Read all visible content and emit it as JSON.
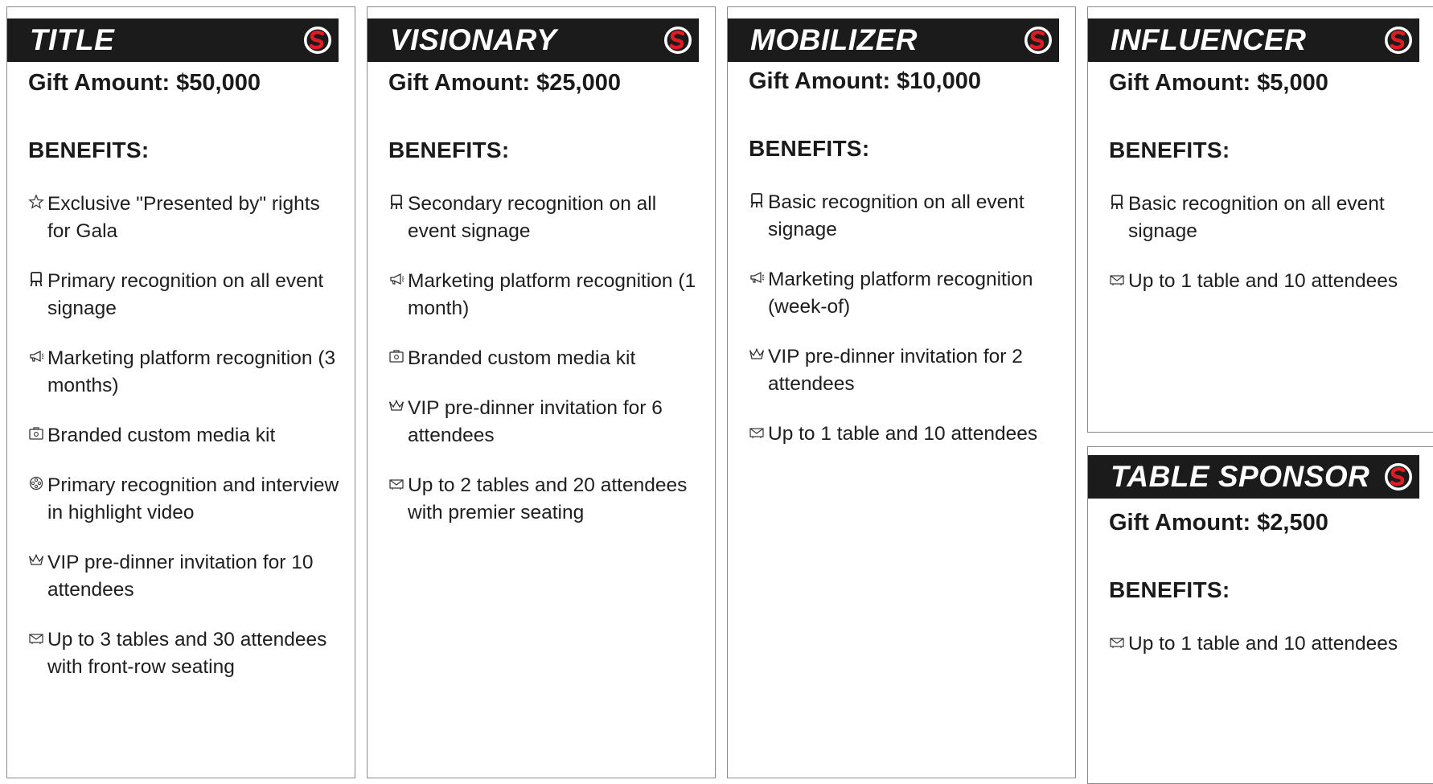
{
  "tiers": [
    {
      "name": "TITLE",
      "gift": "Gift Amount: $50,000",
      "benefits_heading": "BENEFITS:",
      "benefits": [
        {
          "icon": "star-icon",
          "text": "Exclusive \"Presented by\" rights for Gala"
        },
        {
          "icon": "signage-icon",
          "text": "Primary recognition on all event signage"
        },
        {
          "icon": "megaphone-icon",
          "text": "Marketing platform recognition (3 months)"
        },
        {
          "icon": "media-kit-icon",
          "text": "Branded custom media kit"
        },
        {
          "icon": "film-reel-icon",
          "text": "Primary recognition and interview in highlight video"
        },
        {
          "icon": "crown-icon",
          "text": "VIP pre-dinner invitation for 10 attendees"
        },
        {
          "icon": "ticket-icon",
          "text": "Up to 3 tables and 30 attendees with front-row seating"
        }
      ]
    },
    {
      "name": "VISIONARY",
      "gift": "Gift Amount: $25,000",
      "benefits_heading": "BENEFITS:",
      "benefits": [
        {
          "icon": "signage-icon",
          "text": "Secondary recognition on all event signage"
        },
        {
          "icon": "megaphone-icon",
          "text": "Marketing platform recognition (1 month)"
        },
        {
          "icon": "media-kit-icon",
          "text": "Branded custom media kit"
        },
        {
          "icon": "crown-icon",
          "text": "VIP pre-dinner invitation for 6 attendees"
        },
        {
          "icon": "ticket-icon",
          "text": "Up to 2 tables and 20 attendees with premier seating"
        }
      ]
    },
    {
      "name": "MOBILIZER",
      "gift": "Gift Amount: $10,000",
      "benefits_heading": "BENEFITS:",
      "benefits": [
        {
          "icon": "signage-icon",
          "text": "Basic recognition on all event signage"
        },
        {
          "icon": "megaphone-icon",
          "text": "Marketing platform recognition (week-of)"
        },
        {
          "icon": "crown-icon",
          "text": "VIP pre-dinner invitation for 2 attendees"
        },
        {
          "icon": "ticket-icon",
          "text": "Up to 1 table and 10 attendees"
        }
      ]
    },
    {
      "name": "INFLUENCER",
      "gift": "Gift Amount: $5,000",
      "benefits_heading": "BENEFITS:",
      "benefits": [
        {
          "icon": "signage-icon",
          "text": "Basic recognition on all event signage"
        },
        {
          "icon": "ticket-icon",
          "text": "Up to 1 table and 10 attendees"
        }
      ]
    },
    {
      "name": "TABLE SPONSOR",
      "gift": "Gift Amount: $2,500",
      "benefits_heading": "BENEFITS:",
      "benefits": [
        {
          "icon": "ticket-icon",
          "text": "Up to 1 table and 10 attendees"
        }
      ]
    }
  ],
  "colors": {
    "band": "#1b1b1b",
    "logo_red": "#e21b23",
    "border": "#8a8a8a"
  }
}
